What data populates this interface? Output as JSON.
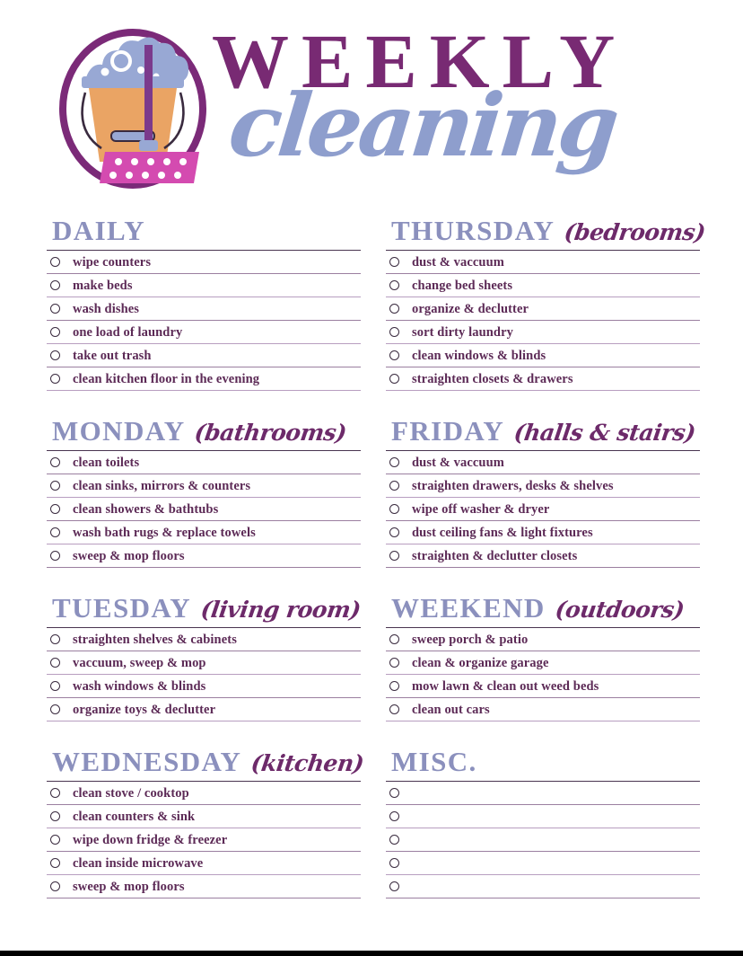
{
  "header": {
    "title_main": "WEEKLY",
    "title_script": "cleaning",
    "logo_icon": "cleaning-bucket-mop-icon"
  },
  "colors": {
    "title_purple": "#782a73",
    "script_blue": "#8e9ecd",
    "heading_blue": "#8b90bd",
    "note_purple": "#6d2a6a",
    "item_text": "#5c2a56",
    "rule_dark": "#4a3550",
    "rule_light": "#b89ec0",
    "bucket_orange": "#eaa464",
    "suds_blue": "#98a8d4",
    "brush_pink": "#d44bb0"
  },
  "columns": [
    {
      "sections": [
        {
          "day": "DAILY",
          "note": "",
          "items": [
            "wipe counters",
            "make beds",
            "wash dishes",
            "one load of laundry",
            "take out trash",
            "clean kitchen floor in the evening"
          ]
        },
        {
          "day": "MONDAY",
          "note": "(bathrooms)",
          "items": [
            "clean toilets",
            "clean sinks, mirrors & counters",
            "clean showers & bathtubs",
            "wash bath rugs & replace towels",
            "sweep & mop floors"
          ]
        },
        {
          "day": "TUESDAY",
          "note": "(living room)",
          "items": [
            "straighten shelves & cabinets",
            "vaccuum, sweep & mop",
            "wash windows & blinds",
            "organize toys & declutter"
          ]
        },
        {
          "day": "WEDNESDAY",
          "note": "(kitchen)",
          "items": [
            "clean stove / cooktop",
            "clean counters & sink",
            "wipe down fridge & freezer",
            "clean inside microwave",
            "sweep & mop floors"
          ]
        }
      ]
    },
    {
      "sections": [
        {
          "day": "THURSDAY",
          "note": "(bedrooms)",
          "items": [
            "dust & vaccuum",
            "change bed sheets",
            "organize & declutter",
            "sort dirty laundry",
            "clean windows & blinds",
            "straighten closets & drawers"
          ]
        },
        {
          "day": "FRIDAY",
          "note": "(halls & stairs)",
          "items": [
            "dust & vaccuum",
            "straighten drawers, desks & shelves",
            "wipe off washer & dryer",
            "dust ceiling fans & light fixtures",
            "straighten & declutter closets"
          ]
        },
        {
          "day": "WEEKEND",
          "note": "(outdoors)",
          "items": [
            "sweep porch & patio",
            "clean & organize garage",
            "mow lawn & clean out weed beds",
            "clean out cars"
          ]
        },
        {
          "day": "MISC.",
          "note": "",
          "items": [
            "",
            "",
            "",
            "",
            ""
          ]
        }
      ]
    }
  ]
}
